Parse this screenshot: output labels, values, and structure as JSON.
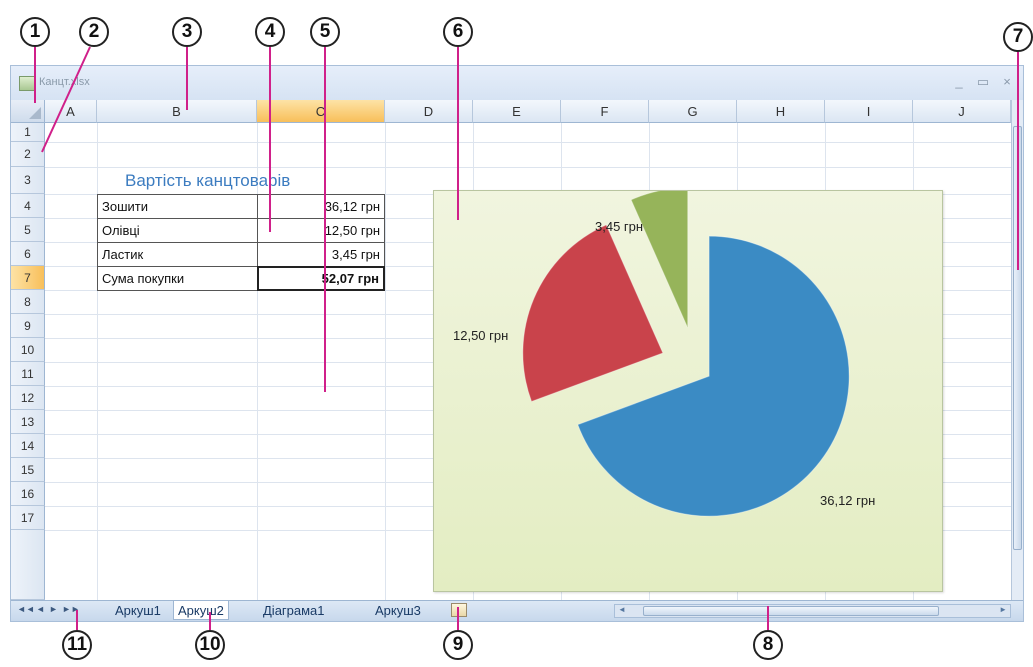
{
  "window": {
    "title": "Канцт.xlsx",
    "controls": {
      "minimize": "_",
      "maximize": "▭",
      "close": "×"
    }
  },
  "columns": [
    "A",
    "B",
    "C",
    "D",
    "E",
    "F",
    "G",
    "H",
    "I",
    "J"
  ],
  "selected_column": "C",
  "rows": [
    "1",
    "2",
    "3",
    "4",
    "5",
    "6",
    "7",
    "8",
    "9",
    "10",
    "11",
    "12",
    "13",
    "14",
    "15",
    "16",
    "17"
  ],
  "selected_row": "7",
  "table": {
    "title": "Вартість канцтоварів",
    "items": [
      {
        "name": "Зошити",
        "value": "36,12 грн"
      },
      {
        "name": "Олівці",
        "value": "12,50 грн"
      },
      {
        "name": "Ластик",
        "value": "3,45 грн"
      }
    ],
    "total": {
      "name": "Сума покупки",
      "value": "52,07 грн"
    }
  },
  "chart_data": {
    "type": "pie",
    "title": "",
    "categories": [
      "Зошити",
      "Олівці",
      "Ластик"
    ],
    "values": [
      36.12,
      12.5,
      3.45
    ],
    "data_labels": [
      "36,12 грн",
      "12,50 грн",
      "3,45 грн"
    ],
    "colors": [
      "#3b8bc4",
      "#c9434b",
      "#96b45a"
    ],
    "exploded": true,
    "legend": "none",
    "background": "#eaf1d1"
  },
  "sheet_tabs": [
    {
      "label": "Аркуш1",
      "active": false
    },
    {
      "label": "Аркуш2",
      "active": true
    },
    {
      "label": "Діаграма1",
      "active": false
    },
    {
      "label": "Аркуш3",
      "active": false
    }
  ],
  "nav_arrows": [
    "◄◄",
    "◄",
    "►",
    "►►"
  ],
  "callouts": [
    "1",
    "2",
    "3",
    "4",
    "5",
    "6",
    "7",
    "8",
    "9",
    "10",
    "11"
  ],
  "icons": {
    "file": "excel-file-icon",
    "new_sheet": "insert-worksheet-icon"
  }
}
